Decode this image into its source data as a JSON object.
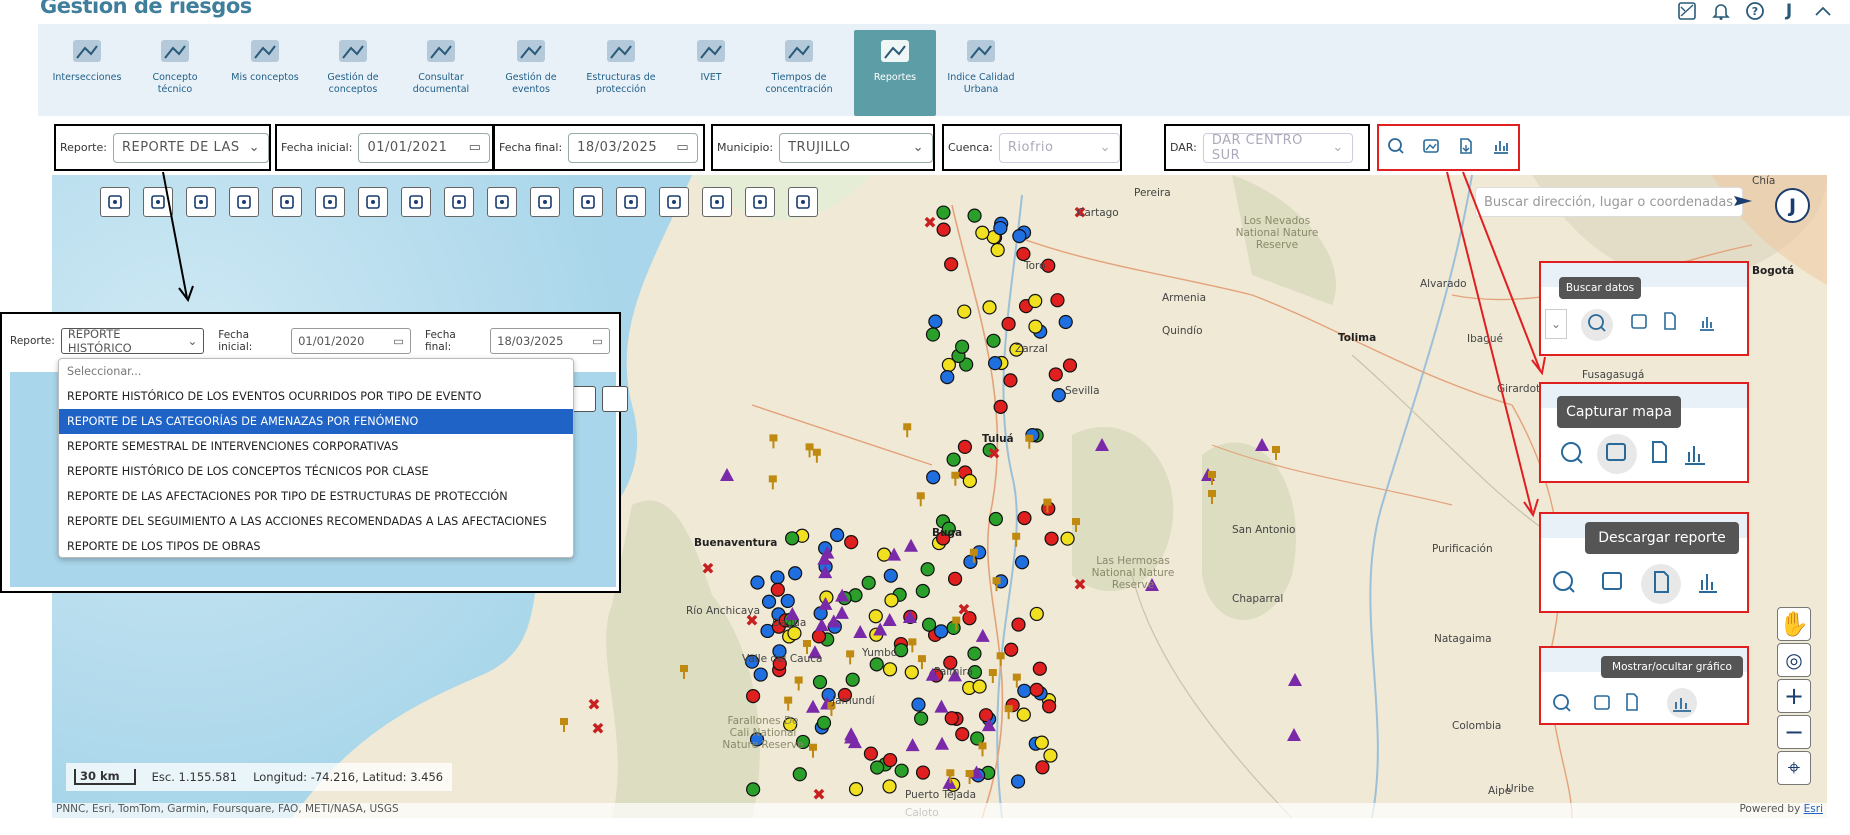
{
  "header": {
    "title": "Gestión de riesgos"
  },
  "top_icons": [
    "map-settings-icon",
    "bell-icon",
    "help-icon",
    "user-initial",
    "chevron-up-icon"
  ],
  "user_initial": "J",
  "nav": [
    {
      "label": "Intersecciones"
    },
    {
      "label": "Concepto técnico"
    },
    {
      "label": "Mis conceptos"
    },
    {
      "label": "Gestión de conceptos"
    },
    {
      "label": "Consultar documental"
    },
    {
      "label": "Gestión de eventos"
    },
    {
      "label": "Estructuras de protección"
    },
    {
      "label": "IVET"
    },
    {
      "label": "Tiempos de concentración"
    },
    {
      "label": "Reportes",
      "active": true
    },
    {
      "label": "Indice Calidad Urbana"
    }
  ],
  "filters": {
    "reporte": {
      "label": "Reporte:",
      "value": "REPORTE DE LAS CA"
    },
    "fecha_inicial": {
      "label": "Fecha inicial:",
      "value": "01/01/2021"
    },
    "fecha_final": {
      "label": "Fecha final:",
      "value": "18/03/2025"
    },
    "municipio": {
      "label": "Municipio:",
      "value": "TRUJILLO"
    },
    "cuenca": {
      "label": "Cuenca:",
      "value": "Riofrio"
    },
    "dar": {
      "label": "DAR:",
      "value": "DAR CENTRO SUR"
    }
  },
  "action_icons": [
    "search-icon",
    "capture-map-icon",
    "download-report-icon",
    "chart-icon"
  ],
  "map": {
    "search_placeholder": "Buscar dirección, lugar o coordenadas",
    "user_initial": "J",
    "scale_bar": "30 km",
    "scale_text": "Esc. 1.155.581",
    "coords": "Longitud: -74.216, Latitud: 3.456",
    "attribution": "PNNC, Esri, TomTom, Garmin, Foursquare, FAO, METI/NASA, USGS",
    "powered": "Powered by ",
    "powered_link": "Esri",
    "labels": [
      {
        "t": "Pereira"
      },
      {
        "t": "Cartago"
      },
      {
        "t": "Armenia"
      },
      {
        "t": "Quindío"
      },
      {
        "t": "Toro"
      },
      {
        "t": "Zarzal"
      },
      {
        "t": "Sevilla"
      },
      {
        "t": "Tuluá"
      },
      {
        "t": "Buga"
      },
      {
        "t": "Buenaventura"
      },
      {
        "t": "Río Anchicaya"
      },
      {
        "t": "Palmira"
      },
      {
        "t": "Puerto Tejada"
      },
      {
        "t": "Farallones De Cali National Nature Reserve"
      },
      {
        "t": "Las Hermosas National Nature Reserve"
      },
      {
        "t": "Los Nevados National Nature Reserve"
      },
      {
        "t": "Tolima"
      },
      {
        "t": "Ibagué"
      },
      {
        "t": "Girardot"
      },
      {
        "t": "Fusagasugá"
      },
      {
        "t": "Bogotá"
      },
      {
        "t": "Alvarado"
      },
      {
        "t": "San Antonio"
      },
      {
        "t": "Purificación"
      },
      {
        "t": "Chaparral"
      },
      {
        "t": "Natagaima"
      },
      {
        "t": "Colombia"
      },
      {
        "t": "Aipe"
      },
      {
        "t": "Uribe"
      },
      {
        "t": "Chía"
      },
      {
        "t": "Caloto"
      },
      {
        "t": "Yumbo"
      },
      {
        "t": "Valle del Cauca"
      },
      {
        "t": "Jamundí"
      },
      {
        "t": "Dagua"
      }
    ]
  },
  "callout": {
    "reporte_label": "Reporte:",
    "reporte_value": "REPORTE HISTÓRICO",
    "fi_label": "Fecha inicial:",
    "fi_value": "01/01/2020",
    "ff_label": "Fecha final:",
    "ff_value": "18/03/2025",
    "options": [
      "Seleccionar...",
      "REPORTE HISTÓRICO DE LOS EVENTOS OCURRIDOS POR TIPO DE EVENTO",
      "REPORTE DE LAS CATEGORÍAS DE AMENAZAS POR FENÓMENO",
      "REPORTE SEMESTRAL DE INTERVENCIONES CORPORATIVAS",
      "REPORTE HISTÓRICO DE LOS CONCEPTOS TÉCNICOS POR CLASE",
      "REPORTE DE LAS AFECTACIONES POR TIPO DE ESTRUCTURAS DE PROTECCIÓN",
      "REPORTE DEL SEGUIMIENTO A LAS ACCIONES RECOMENDADAS A LAS AFECTACIONES",
      "REPORTE DE LOS TIPOS DE OBRAS"
    ],
    "selected_index": 2
  },
  "tooltips": {
    "buscar": "Buscar datos",
    "capturar": "Capturar mapa",
    "descargar": "Descargar reporte",
    "mostrar": "Mostrar/ocultar gráfico"
  },
  "colors": {
    "accent": "#3f7f9b",
    "active_tab": "#5d9ea6",
    "highlight": "#1f63c7",
    "callout_border": "#e02020"
  }
}
